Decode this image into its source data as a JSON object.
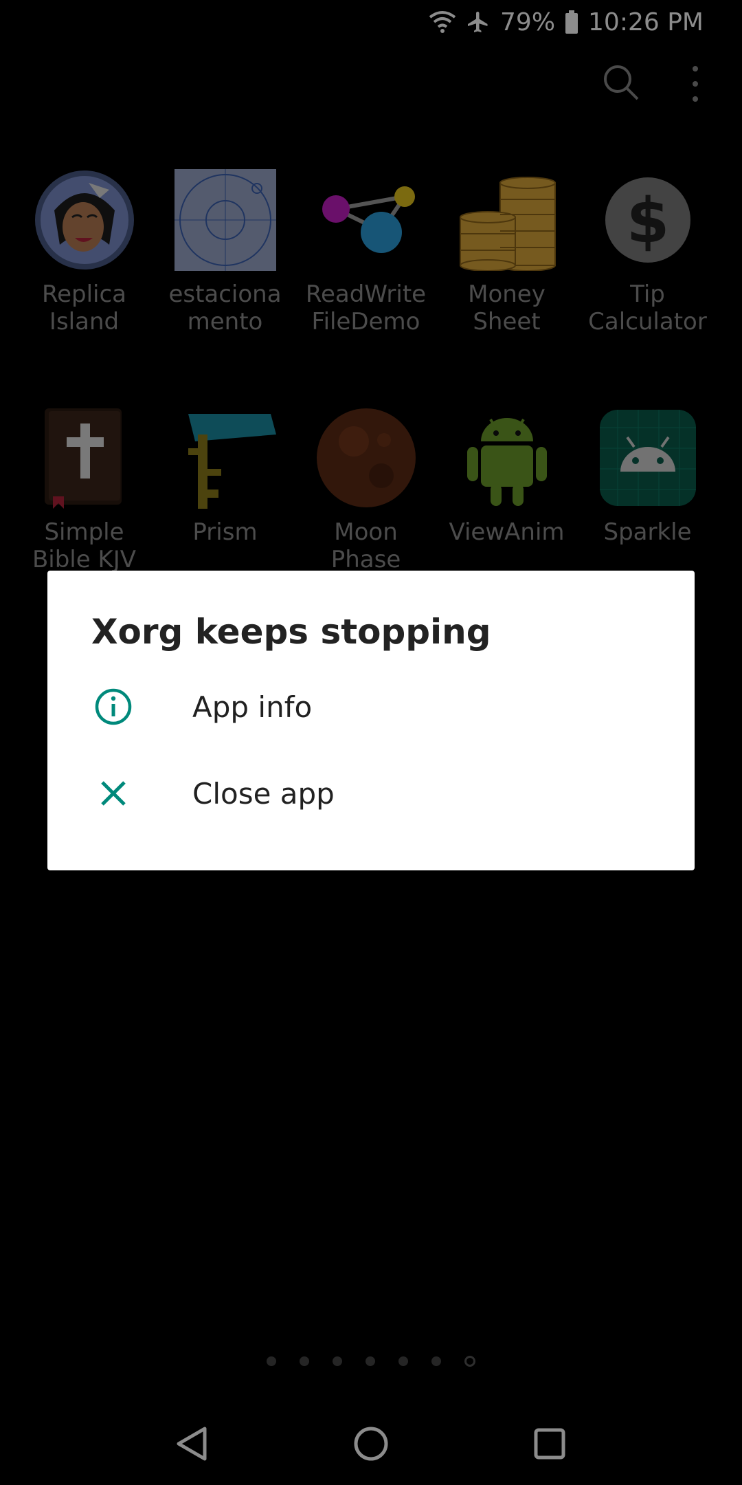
{
  "status_bar": {
    "battery_percent": "79%",
    "time": "10:26 PM",
    "icons": [
      "wifi-icon",
      "airplane-mode-icon",
      "battery-icon"
    ]
  },
  "toolbar": {
    "icons": [
      "search-icon",
      "more-options-icon"
    ]
  },
  "apps": [
    {
      "label": "Replica\nIsland",
      "icon": "replica-island-icon"
    },
    {
      "label": "estaciona\nmento",
      "icon": "estacionamento-icon"
    },
    {
      "label": "ReadWrite\nFileDemo",
      "icon": "readwrite-filedemo-icon"
    },
    {
      "label": "Money\nSheet",
      "icon": "money-sheet-icon"
    },
    {
      "label": "Tip\nCalculator",
      "icon": "tip-calculator-icon"
    },
    {
      "label": "Simple\nBible KJV",
      "icon": "simple-bible-icon"
    },
    {
      "label": "Prism",
      "icon": "prism-icon"
    },
    {
      "label": "Moon\nPhase",
      "icon": "moon-phase-icon"
    },
    {
      "label": "ViewAnim",
      "icon": "viewanim-icon"
    },
    {
      "label": "Sparkle",
      "icon": "sparkle-icon"
    }
  ],
  "page_indicator": {
    "total": 7,
    "current": 7
  },
  "dialog": {
    "title": "Xorg keeps stopping",
    "items": [
      {
        "label": "App info",
        "icon": "info-icon"
      },
      {
        "label": "Close app",
        "icon": "close-icon"
      }
    ]
  },
  "nav_bar": {
    "buttons": [
      "back-icon",
      "home-icon",
      "recents-icon"
    ]
  },
  "colors": {
    "accent": "#00897b",
    "dialog_bg": "#ffffff",
    "background": "#000000"
  }
}
